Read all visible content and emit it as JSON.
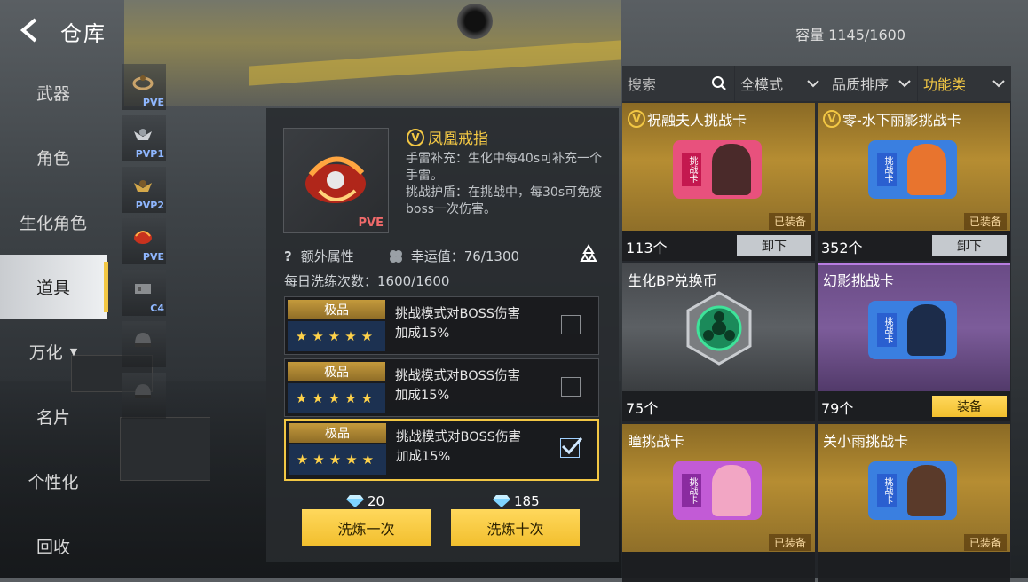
{
  "header": {
    "title": "仓库",
    "capacity": "容量 1145/1600"
  },
  "menu": [
    {
      "label": "武器",
      "active": false
    },
    {
      "label": "角色",
      "active": false
    },
    {
      "label": "生化角色",
      "active": false
    },
    {
      "label": "道具",
      "active": true
    },
    {
      "label": "万化",
      "active": false,
      "has_dropdown": true
    },
    {
      "label": "名片",
      "active": false
    },
    {
      "label": "个性化",
      "active": false
    },
    {
      "label": "回收",
      "active": false
    }
  ],
  "slots": [
    {
      "tag": "PVE",
      "icon": "ring-icon"
    },
    {
      "tag": "PVP1",
      "icon": "wings-emblem-icon"
    },
    {
      "tag": "PVP2",
      "icon": "wings-emblem-icon"
    },
    {
      "tag": "PVE",
      "icon": "phoenix-ring-icon",
      "selected": true
    },
    {
      "tag": "C4",
      "icon": "c4-icon"
    },
    {
      "tag": "",
      "icon": "helmet-icon"
    },
    {
      "tag": "",
      "icon": "helmet-icon"
    }
  ],
  "detail": {
    "name": "凤凰戒指",
    "badge": "V",
    "mode_tag": "PVE",
    "desc_line1": "手雷补充：生化中每40s可补充一个手雷。",
    "desc_line2": "挑战护盾：在挑战中，每30s可免疫boss一次伤害。",
    "extra_label": "额外属性",
    "extra_q": "?",
    "luck": "幸运值：76/1300",
    "daily": "每日洗练次数：1600/1600",
    "attrs": [
      {
        "grade": "极品",
        "stars": "★★★★★",
        "line1": "挑战模式对BOSS伤害",
        "line2": "加成15%",
        "checked": false
      },
      {
        "grade": "极品",
        "stars": "★★★★★",
        "line1": "挑战模式对BOSS伤害",
        "line2": "加成15%",
        "checked": false
      },
      {
        "grade": "极品",
        "stars": "★★★★★",
        "line1": "挑战模式对BOSS伤害",
        "line2": "加成15%",
        "checked": true
      }
    ],
    "cost_once": "20",
    "cost_ten": "185",
    "btn_once": "洗炼一次",
    "btn_ten": "洗炼十次"
  },
  "filters": {
    "search_placeholder": "搜索",
    "mode": "全模式",
    "sort": "品质排序",
    "category": "功能类"
  },
  "cards": [
    {
      "name": "祝融夫人挑战卡",
      "badge": "V",
      "rarity": "gold",
      "equipped": "已装备",
      "count": "113个",
      "action": "卸下",
      "action_type": "unequip",
      "art_color": "#e8517d",
      "chip": "挑战卡"
    },
    {
      "name": "零-水下丽影挑战卡",
      "badge": "V",
      "rarity": "gold",
      "equipped": "已装备",
      "count": "352个",
      "action": "卸下",
      "action_type": "unequip",
      "art_color": "#3a7fe0",
      "chip": "挑战卡"
    },
    {
      "name": "生化BP兑换币",
      "badge": "",
      "rarity": "silver",
      "equipped": "",
      "count": "75个",
      "action": "",
      "action_type": "none",
      "art_color": "",
      "chip": ""
    },
    {
      "name": "幻影挑战卡",
      "badge": "",
      "rarity": "purple",
      "equipped": "",
      "count": "79个",
      "action": "装备",
      "action_type": "equip",
      "art_color": "#3a7fe0",
      "chip": "挑战卡"
    },
    {
      "name": "瞳挑战卡",
      "badge": "",
      "rarity": "gold",
      "equipped": "已装备",
      "count": "",
      "action": "",
      "action_type": "none",
      "art_color": "#c25bd6",
      "chip": "挑战卡"
    },
    {
      "name": "关小雨挑战卡",
      "badge": "",
      "rarity": "gold",
      "equipped": "已装备",
      "count": "",
      "action": "",
      "action_type": "none",
      "art_color": "#3a7fe0",
      "chip": "挑战卡"
    }
  ]
}
